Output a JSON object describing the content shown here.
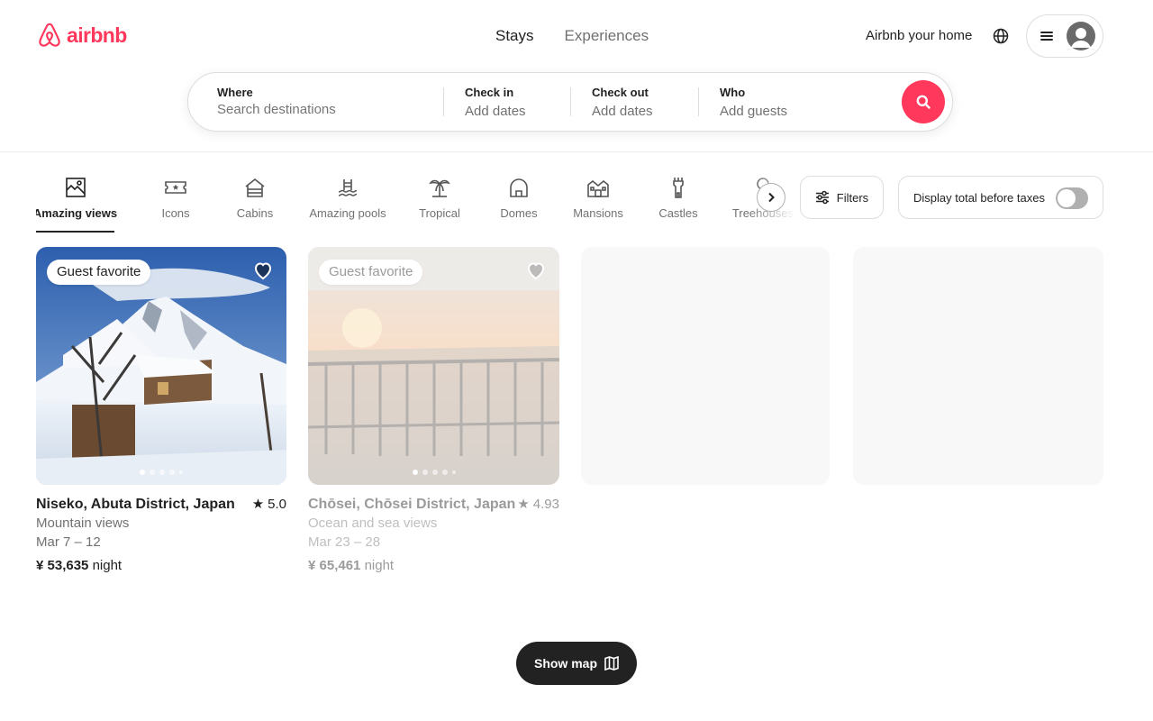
{
  "header": {
    "logo_text": "airbnb",
    "brand_color": "#ff385c",
    "tabs": [
      {
        "label": "Stays",
        "active": true
      },
      {
        "label": "Experiences",
        "active": false
      }
    ],
    "host_link": "Airbnb your home"
  },
  "search": {
    "where": {
      "label": "Where",
      "placeholder": "Search destinations"
    },
    "check_in": {
      "label": "Check in",
      "value": "Add dates"
    },
    "check_out": {
      "label": "Check out",
      "value": "Add dates"
    },
    "who": {
      "label": "Who",
      "value": "Add guests"
    }
  },
  "categories": [
    {
      "label": "Amazing views",
      "icon": "amazing-views-icon",
      "active": true
    },
    {
      "label": "Icons",
      "icon": "icons-ticket-icon",
      "active": false
    },
    {
      "label": "Cabins",
      "icon": "cabin-icon",
      "active": false
    },
    {
      "label": "Amazing pools",
      "icon": "pool-icon",
      "active": false
    },
    {
      "label": "Tropical",
      "icon": "palm-tree-icon",
      "active": false
    },
    {
      "label": "Domes",
      "icon": "dome-icon",
      "active": false
    },
    {
      "label": "Mansions",
      "icon": "mansion-icon",
      "active": false
    },
    {
      "label": "Castles",
      "icon": "castle-icon",
      "active": false
    },
    {
      "label": "Treehouses",
      "icon": "treehouse-icon",
      "active": false
    }
  ],
  "filters_label": "Filters",
  "taxes_label": "Display total before taxes",
  "taxes_toggle_on": false,
  "listings": [
    {
      "badge": "Guest favorite",
      "title": "Niseko, Abuta District, Japan",
      "rating": "5.0",
      "subtitle": "Mountain views",
      "dates": "Mar 7 – 12",
      "price": "¥ 53,635",
      "price_unit": "night"
    },
    {
      "badge": "Guest favorite",
      "title": "Chōsei, Chōsei District, Japan",
      "rating": "4.93",
      "subtitle": "Ocean and sea views",
      "dates": "Mar 23 – 28",
      "price": "¥ 65,461",
      "price_unit": "night"
    }
  ],
  "show_map_label": "Show map"
}
